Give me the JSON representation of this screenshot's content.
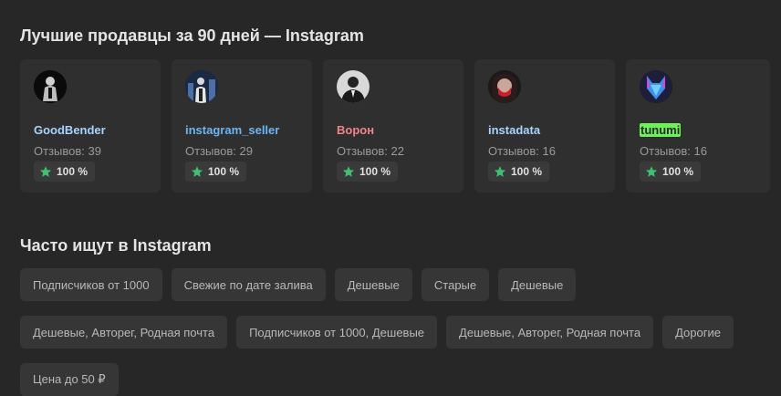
{
  "top_sellers": {
    "title": "Лучшие продавцы за 90 дней — Instagram",
    "sellers": [
      {
        "name": "GoodBender",
        "name_color": "#a9d3ff",
        "reviews": "Отзывов: 39",
        "rating": "100 %",
        "avatar_icon": "dark-figure-avatar"
      },
      {
        "name": "instagram_seller",
        "name_color": "#6cb5f4",
        "reviews": "Отзывов: 29",
        "rating": "100 %",
        "avatar_icon": "city-night-avatar"
      },
      {
        "name": "Ворон",
        "name_color": "#f2848c",
        "reviews": "Отзывов: 22",
        "rating": "100 %",
        "avatar_icon": "suited-man-avatar"
      },
      {
        "name": "instadata",
        "name_color": "#a9d3ff",
        "reviews": "Отзывов: 16",
        "rating": "100 %",
        "avatar_icon": "red-mask-avatar"
      },
      {
        "name": "tunumi",
        "name_color": "#2a2a2a",
        "name_highlight": "#6ef05a",
        "reviews": "Отзывов: 16",
        "rating": "100 %",
        "avatar_icon": "blue-wolf-avatar"
      }
    ],
    "star_color": "#3fbf6f"
  },
  "popular_searches": {
    "title": "Часто ищут в Instagram",
    "chips": [
      "Подписчиков от 1000",
      "Свежие по дате залива",
      "Дешевые",
      "Старые",
      "Дешевые",
      "Дешевые, Авторег, Родная почта",
      "Подписчиков от 1000, Дешевые",
      "Дешевые, Авторег, Родная почта",
      "Дорогие",
      "Цена до 50 ₽"
    ]
  }
}
